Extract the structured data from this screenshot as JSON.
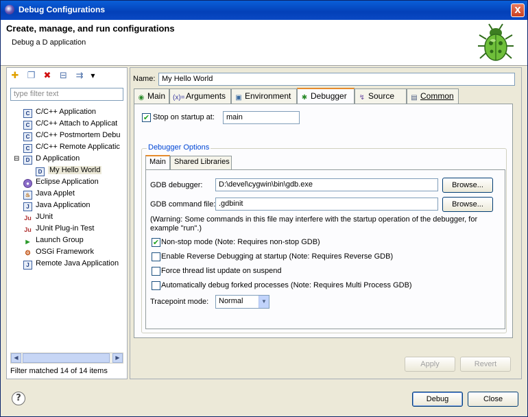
{
  "window": {
    "title": "Debug Configurations",
    "close_glyph": "X"
  },
  "header": {
    "title": "Create, manage, and run configurations",
    "subtitle": "Debug a D application"
  },
  "left": {
    "toolbar": {
      "new_icon": "new-config-icon",
      "duplicate_icon": "duplicate-icon",
      "delete_icon": "delete-icon",
      "collapse_icon": "collapse-all-icon",
      "filter_icon": "filter-icon"
    },
    "filter_placeholder": "type filter text",
    "tree": [
      {
        "label": "C/C++ Application",
        "icon": "C"
      },
      {
        "label": "C/C++ Attach to Applicat",
        "icon": "C"
      },
      {
        "label": "C/C++ Postmortem Debu",
        "icon": "C"
      },
      {
        "label": "C/C++ Remote Applicatic",
        "icon": "C"
      },
      {
        "label": "D Application",
        "icon": "D",
        "expander": "⊟"
      },
      {
        "label": "My Hello World",
        "icon": "D"
      },
      {
        "label": "Eclipse Application",
        "icon": "●"
      },
      {
        "label": "Java Applet",
        "icon": "♨"
      },
      {
        "label": "Java Application",
        "icon": "J"
      },
      {
        "label": "JUnit",
        "icon": "Ju"
      },
      {
        "label": "JUnit Plug-in Test",
        "icon": "Ju"
      },
      {
        "label": "Launch Group",
        "icon": "▶"
      },
      {
        "label": "OSGi Framework",
        "icon": "⚙"
      },
      {
        "label": "Remote Java Application",
        "icon": "J"
      }
    ],
    "status": "Filter matched 14 of 14 items"
  },
  "right": {
    "name_label": "Name:",
    "name_value": "My Hello World",
    "tabs": [
      "Main",
      "Arguments",
      "Environment",
      "Debugger",
      "Source",
      "Common"
    ],
    "active_tab": "Debugger",
    "stop_on_startup": {
      "label": "Stop on startup at:",
      "checked": true,
      "value": "main"
    },
    "debugger_options": {
      "title": "Debugger Options",
      "tabs": [
        "Main",
        "Shared Libraries"
      ],
      "gdb_debugger_label": "GDB debugger:",
      "gdb_debugger_value": "D:\\devel\\cygwin\\bin\\gdb.exe",
      "gdb_command_label": "GDB command file:",
      "gdb_command_value": ".gdbinit",
      "browse_label": "Browse...",
      "warning_line1": "(Warning: Some commands in this file may interfere with the startup operation of the debugger, for",
      "warning_line2": "example \"run\".)",
      "options": [
        {
          "label": "Non-stop mode (Note: Requires non-stop GDB)",
          "checked": true
        },
        {
          "label": "Enable Reverse Debugging at startup (Note: Requires Reverse GDB)",
          "checked": false
        },
        {
          "label": "Force thread list update on suspend",
          "checked": false
        },
        {
          "label": "Automatically debug forked processes (Note: Requires Multi Process GDB)",
          "checked": false
        }
      ],
      "tracepoint_label": "Tracepoint mode:",
      "tracepoint_value": "Normal"
    },
    "apply_label": "Apply",
    "revert_label": "Revert"
  },
  "footer": {
    "debug_label": "Debug",
    "close_label": "Close",
    "help_glyph": "?"
  }
}
